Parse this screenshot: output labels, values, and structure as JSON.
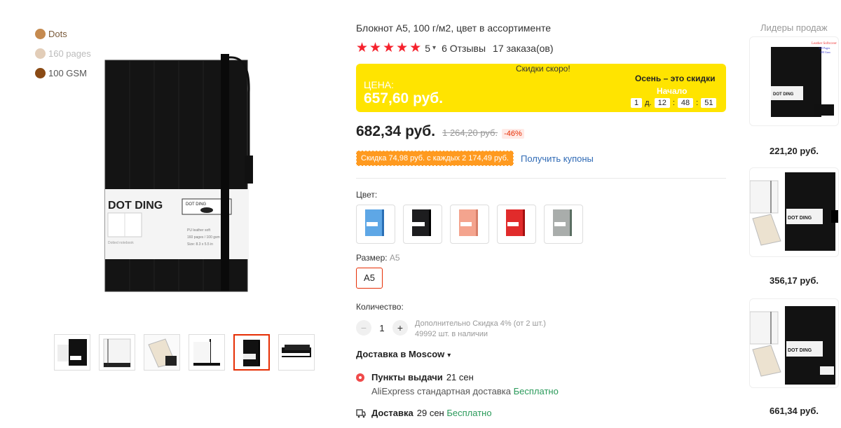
{
  "gallery": {
    "features": [
      {
        "label": "Dots"
      },
      {
        "label": "160 pages"
      },
      {
        "label": "100 GSM"
      }
    ],
    "main_image": {
      "brand_text": "DOT DING",
      "badge_text": "DOT DING",
      "line1": "PU leather soft",
      "line2": "160 pages / 100 gsm",
      "line3": "Size: 8.3 x 5.5 in",
      "caption": "Dotted notebook"
    },
    "thumbnails": 6,
    "active_thumbnail": 5
  },
  "product": {
    "title": "Блокнот А5, 100 г/м2, цвет в ассортименте",
    "rating": "5",
    "reviews": "6 Отзывы",
    "orders": "17 заказа(ов)"
  },
  "promo": {
    "soon": "Скидки скоро!",
    "price_label": "ЦЕНА:",
    "price_value": "657,60 руб.",
    "autumn": "Осень – это скидки",
    "start": "Начало",
    "timer": {
      "days": "1",
      "day_unit": "д.",
      "hours": "12",
      "minutes": "48",
      "seconds": "51"
    }
  },
  "pricing": {
    "price": "682,34 руб.",
    "old_price": "1 264,20 руб.",
    "discount": "-46%",
    "coupon": "Скидка 74,98 руб. с каждых 2 174,49 руб.",
    "get_coupons": "Получить купоны"
  },
  "options": {
    "color_label": "Цвет:",
    "colors": [
      {
        "name": "blue",
        "color": "#5ea7e6"
      },
      {
        "name": "black",
        "color": "#1d1d1f"
      },
      {
        "name": "pink",
        "color": "#f4a48e"
      },
      {
        "name": "red",
        "color": "#e12b2b"
      },
      {
        "name": "gray",
        "color": "#a9adab"
      }
    ],
    "size_label": "Размер:",
    "size_value": "A5",
    "size_button": "A5",
    "qty_label": "Количество:",
    "qty": "1",
    "qty_note1": "Дополнительно Скидка 4% (от 2 шт.)",
    "qty_note2": "49992 шт. в наличии"
  },
  "delivery": {
    "to": "Доставка в Moscow",
    "pickup_title": "Пункты выдачи",
    "pickup_date": "21 сен",
    "pickup_service": "AliExpress стандартная доставка",
    "free": "Бесплатно",
    "courier_title": "Доставка",
    "courier_date": "29 сен",
    "courier_free": "Бесплатно"
  },
  "leaders": {
    "title": "Лидеры продаж",
    "items": [
      {
        "price": "221,20 руб."
      },
      {
        "price": "356,17 руб."
      },
      {
        "price": "661,34 руб."
      }
    ],
    "first_label_lines": [
      "Leather Softcover",
      "160 Pages",
      "100 Gsm"
    ]
  },
  "colors": {
    "accent": "#e62e04",
    "promo_bg": "#ffe400",
    "coupon_bg": "#ff9a1f",
    "link": "#2f6ab5",
    "free": "#2a9a5a"
  }
}
